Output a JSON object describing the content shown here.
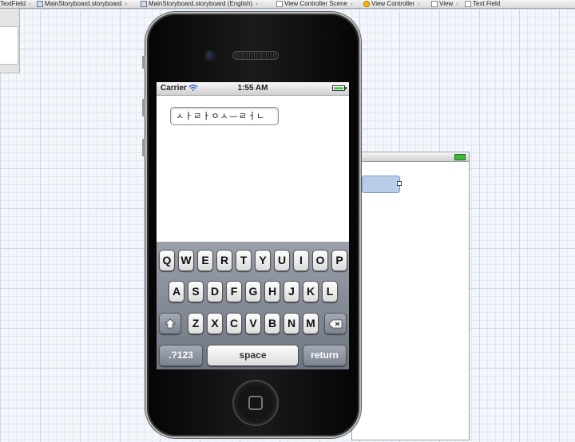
{
  "breadcrumbs": [
    {
      "label": "TextField",
      "icon": "folder-icon"
    },
    {
      "label": "MainStoryboard.storyboard",
      "icon": "storyboard-file-icon"
    },
    {
      "label": "MainStoryboard.storyboard (English)",
      "icon": "storyboard-file-icon"
    },
    {
      "label": "View Controller Scene",
      "icon": "scene-icon"
    },
    {
      "label": "View Controller",
      "icon": "view-controller-icon"
    },
    {
      "label": "View",
      "icon": "view-icon"
    },
    {
      "label": "Text Field",
      "icon": "text-field-icon"
    }
  ],
  "status_bar": {
    "carrier": "Carrier",
    "time": "1:55 AM"
  },
  "text_field": {
    "value": "ㅅㅏㄹㅏㅇㅅ—ㄹㅓㄴ"
  },
  "keyboard": {
    "row1": [
      "Q",
      "W",
      "E",
      "R",
      "T",
      "Y",
      "U",
      "I",
      "O",
      "P"
    ],
    "row2": [
      "A",
      "S",
      "D",
      "F",
      "G",
      "H",
      "J",
      "K",
      "L"
    ],
    "row3": [
      "Z",
      "X",
      "C",
      "V",
      "B",
      "N",
      "M"
    ],
    "shift_icon": "shift-icon",
    "delete_icon": "delete-icon",
    "numbers_label": ".?123",
    "space_label": "space",
    "return_label": "return"
  },
  "colors": {
    "keyboard_bg": "#7c8491",
    "battery": "#1fae1f"
  }
}
